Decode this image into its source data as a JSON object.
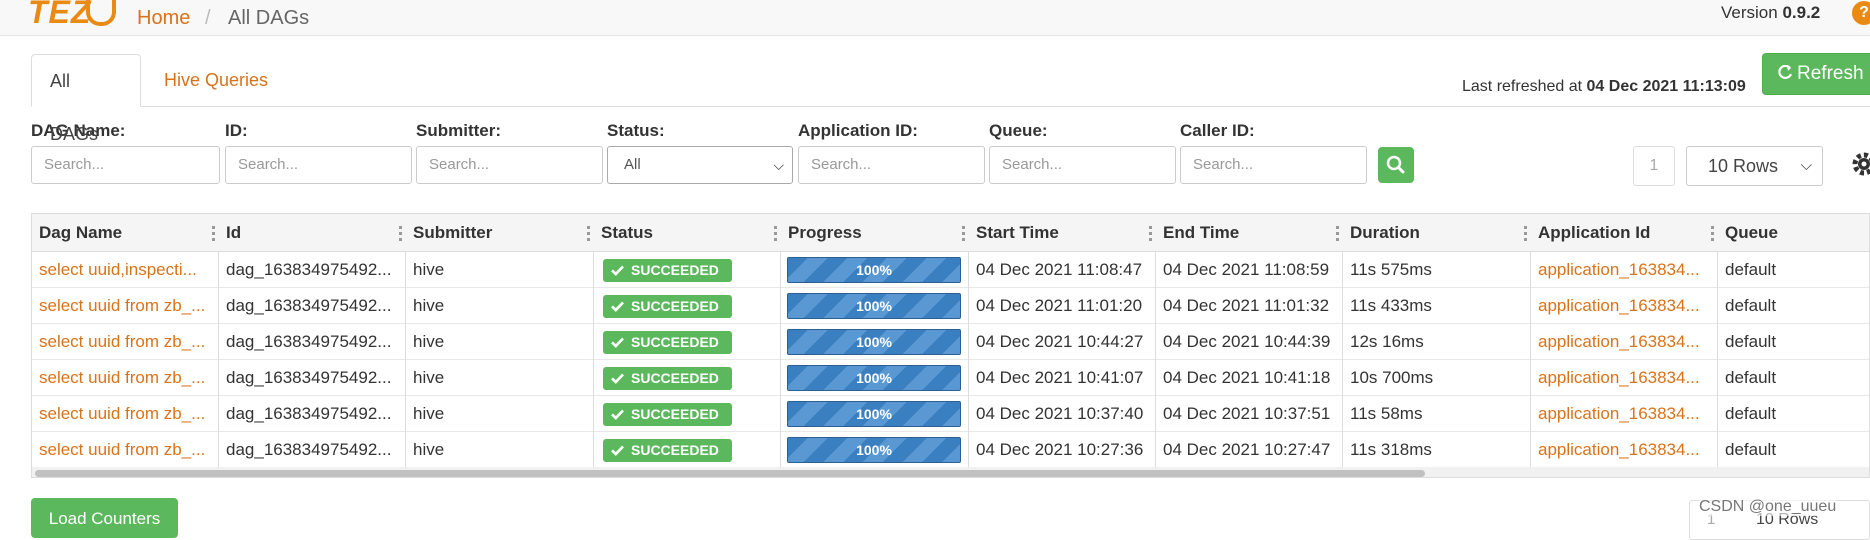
{
  "nav": {
    "logo_text": "TEZ",
    "breadcrumb_home": "Home",
    "breadcrumb_sep": "/",
    "breadcrumb_current": "All DAGs",
    "version_label": "Version",
    "version_value": "0.9.2",
    "help_glyph": "?"
  },
  "tabs": [
    {
      "label": "All DAGs",
      "active": true
    },
    {
      "label": "Hive Queries",
      "active": false
    }
  ],
  "refresh": {
    "last_refreshed_label": "Last refreshed at",
    "last_refreshed_value": "04 Dec 2021 11:13:09",
    "button_label": "Refresh",
    "icon": "refresh-icon"
  },
  "filters": {
    "dag_name": {
      "label": "DAG Name:",
      "placeholder": "Search..."
    },
    "id": {
      "label": "ID:",
      "placeholder": "Search..."
    },
    "submitter": {
      "label": "Submitter:",
      "placeholder": "Search..."
    },
    "status": {
      "label": "Status:",
      "value": "All"
    },
    "application_id": {
      "label": "Application ID:",
      "placeholder": "Search..."
    },
    "queue": {
      "label": "Queue:",
      "placeholder": "Search..."
    },
    "caller_id": {
      "label": "Caller ID:",
      "placeholder": "Search..."
    }
  },
  "pagination": {
    "page": "1",
    "rows": "10 Rows"
  },
  "table": {
    "columns": [
      "Dag Name",
      "Id",
      "Submitter",
      "Status",
      "Progress",
      "Start Time",
      "End Time",
      "Duration",
      "Application Id",
      "Queue"
    ],
    "rows": [
      {
        "dag_name": "select uuid,inspecti...",
        "id": "dag_163834975492...",
        "submitter": "hive",
        "status": "SUCCEEDED",
        "progress": "100%",
        "start": "04 Dec 2021 11:08:47",
        "end": "04 Dec 2021 11:08:59",
        "duration": "11s 575ms",
        "app_id": "application_163834...",
        "queue": "default"
      },
      {
        "dag_name": "select uuid from zb_...",
        "id": "dag_163834975492...",
        "submitter": "hive",
        "status": "SUCCEEDED",
        "progress": "100%",
        "start": "04 Dec 2021 11:01:20",
        "end": "04 Dec 2021 11:01:32",
        "duration": "11s 433ms",
        "app_id": "application_163834...",
        "queue": "default"
      },
      {
        "dag_name": "select uuid from zb_...",
        "id": "dag_163834975492...",
        "submitter": "hive",
        "status": "SUCCEEDED",
        "progress": "100%",
        "start": "04 Dec 2021 10:44:27",
        "end": "04 Dec 2021 10:44:39",
        "duration": "12s 16ms",
        "app_id": "application_163834...",
        "queue": "default"
      },
      {
        "dag_name": "select uuid from zb_...",
        "id": "dag_163834975492...",
        "submitter": "hive",
        "status": "SUCCEEDED",
        "progress": "100%",
        "start": "04 Dec 2021 10:41:07",
        "end": "04 Dec 2021 10:41:18",
        "duration": "10s 700ms",
        "app_id": "application_163834...",
        "queue": "default"
      },
      {
        "dag_name": "select uuid from zb_...",
        "id": "dag_163834975492...",
        "submitter": "hive",
        "status": "SUCCEEDED",
        "progress": "100%",
        "start": "04 Dec 2021 10:37:40",
        "end": "04 Dec 2021 10:37:51",
        "duration": "11s 58ms",
        "app_id": "application_163834...",
        "queue": "default"
      },
      {
        "dag_name": "select uuid from zb_...",
        "id": "dag_163834975492...",
        "submitter": "hive",
        "status": "SUCCEEDED",
        "progress": "100%",
        "start": "04 Dec 2021 10:27:36",
        "end": "04 Dec 2021 10:27:47",
        "duration": "11s 318ms",
        "app_id": "application_163834...",
        "queue": "default"
      }
    ]
  },
  "footer": {
    "load_counters_label": "Load Counters",
    "page": "1",
    "rows": "10 Rows",
    "watermark": "CSDN @one_uueu"
  },
  "colors": {
    "accent": "#d9731a",
    "success": "#5cb85c",
    "progress": "#3a7fc0"
  }
}
